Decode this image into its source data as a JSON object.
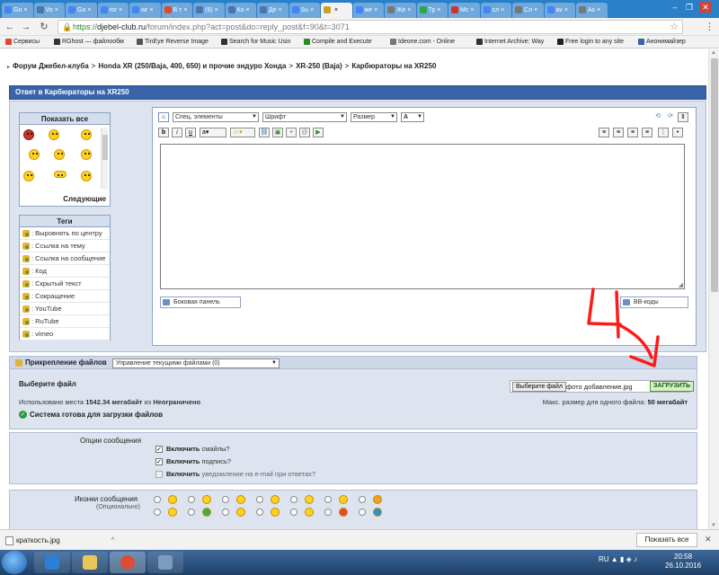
{
  "browser": {
    "tabs": [
      {
        "label": "Go",
        "color": "#4285f4"
      },
      {
        "label": "Vo",
        "color": "#4a76a8"
      },
      {
        "label": "Go",
        "color": "#4285f4"
      },
      {
        "label": "ror",
        "color": "#4285f4"
      },
      {
        "label": "wr",
        "color": "#4285f4"
      },
      {
        "label": "В т",
        "color": "#e04a2a"
      },
      {
        "label": "(6)",
        "color": "#4a76a8"
      },
      {
        "label": "Ко",
        "color": "#4a76a8"
      },
      {
        "label": "Де",
        "color": "#4a76a8"
      },
      {
        "label": "Su",
        "color": "#4285f4"
      },
      {
        "label": "",
        "color": "#c9a227",
        "active": true
      },
      {
        "label": "же",
        "color": "#4285f4"
      },
      {
        "label": "Же",
        "color": "#777777"
      },
      {
        "label": "Тр",
        "color": "#2aa84a"
      },
      {
        "label": "Mc",
        "color": "#d93025"
      },
      {
        "label": "сл",
        "color": "#4285f4"
      },
      {
        "label": "Сл",
        "color": "#777777"
      },
      {
        "label": "av",
        "color": "#4285f4"
      },
      {
        "label": "As",
        "color": "#777777"
      }
    ],
    "url": {
      "scheme": "https://",
      "host": "djebel-club.ru",
      "path": "/forum/index.php?act=post&do=reply_post&f=90&t=3071"
    },
    "bookmarks": [
      {
        "label": "Сервисы",
        "color": "#e04a2a"
      },
      {
        "label": "RGhost — файлообм",
        "color": "#333333"
      },
      {
        "label": "TinEye Reverse Image",
        "color": "#555555"
      },
      {
        "label": "Search for Music Usin",
        "color": "#333333"
      },
      {
        "label": "Compile and Execute",
        "color": "#2a8a2a"
      },
      {
        "label": "Ideone.com - Online",
        "color": "#777777"
      },
      {
        "label": "Internet Archive: Way",
        "color": "#333333"
      },
      {
        "label": "Free login to any site",
        "color": "#222222"
      },
      {
        "label": "Анонимайзер",
        "color": "#3a63a8"
      }
    ]
  },
  "breadcrumb": [
    "Форум Джебел-клуба",
    "Honda XR (250/Baja, 400, 650) и прочие эндуро Хонда",
    "XR-250 (Baja)",
    "Карбюраторы на XR250"
  ],
  "reply": {
    "title": "Ответ в Карбюраторы на XR250"
  },
  "smilies": {
    "title": "Показать все",
    "next": "Следующие"
  },
  "tags": {
    "title": "Теги",
    "items": [
      ": Выровнять по центру",
      ": Ссылка на тему",
      ": Ссылка на сообщение",
      ": Код",
      ": Скрытый текст",
      ": Сокращение",
      ": YouTube",
      ": RuTube",
      ": vimeo"
    ]
  },
  "editor": {
    "special": "Спец. элементы",
    "font": "Шрифт",
    "size": "Размер",
    "color_btn": "A",
    "bold": "b",
    "italic": "i",
    "underline": "u",
    "sidebar_btn": "Боковая панель",
    "bbcode_btn": "BB-коды"
  },
  "attach": {
    "title": "Прикрепление файлов",
    "manage": "Управление текущими файлами (0)",
    "choose_label": "Выберите файл",
    "usage_prefix": "Использовано места",
    "usage_value": "1542.34 мегабайт",
    "usage_mid": "из",
    "usage_limit": "Неограничено",
    "ready": "Система готова для загрузки файлов",
    "choose_btn": "Выберите файл",
    "file_name": "фото добавление.jpg",
    "upload_btn": "ЗАГРУЗИТЬ",
    "max_prefix": "Макс. размер для одного файла:",
    "max_value": "50 мегабайт"
  },
  "options": {
    "label": "Опции сообщения",
    "items": [
      {
        "bold": "Включить",
        "rest": "смайлы?",
        "checked": true
      },
      {
        "bold": "Включить",
        "rest": "подпись?",
        "checked": true
      },
      {
        "bold": "Включить",
        "rest": "уведомление на e-mail при ответах?",
        "checked": false
      }
    ]
  },
  "icons": {
    "label": "Иконки сообщения",
    "sub": "(Опционально)"
  },
  "annotation": {
    "text": "4",
    "color": "#ff1a1a"
  },
  "download": {
    "file": "краткость.jpg",
    "show_all": "Показать все"
  },
  "taskbar": {
    "lang": "RU",
    "time": "20:58",
    "date": "26.10.2016"
  }
}
